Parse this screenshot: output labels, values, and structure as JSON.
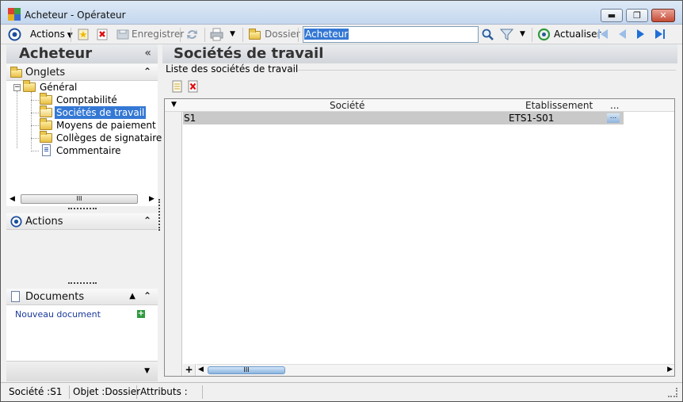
{
  "window": {
    "title": "Acheteur -  Opérateur",
    "min_label": "▬",
    "max_label": "❐",
    "close_label": "✕"
  },
  "toolbar": {
    "actions_label": "Actions",
    "save_label": "Enregistrer",
    "folder_label": "Dossier",
    "search_value": "Acheteur",
    "refresh_label": "Actualiser"
  },
  "left": {
    "title": "Acheteur",
    "collapse_glyph": "«",
    "tabs_header": "Onglets",
    "tree": {
      "root": "Général",
      "items": [
        {
          "label": "Comptabilité",
          "selected": false
        },
        {
          "label": "Sociétés de travail",
          "selected": true
        },
        {
          "label": "Moyens de paiement",
          "selected": false
        },
        {
          "label": "Collèges de signataire",
          "selected": false
        },
        {
          "label": "Commentaire",
          "selected": false
        }
      ]
    },
    "actions_header": "Actions",
    "documents_header": "Documents",
    "new_document_link": "Nouveau document",
    "scroll_grip": "III"
  },
  "main": {
    "title": "Sociétés de travail",
    "group_label": "Liste des sociétés de travail",
    "grid": {
      "columns": [
        "Société",
        "Etablissement",
        "..."
      ],
      "rows": [
        {
          "societe": "S1",
          "etablissement": "ETS1-S01"
        }
      ],
      "row_ellipsis": "...",
      "add_row_glyph": "+"
    }
  },
  "statusbar": {
    "societe": "Société :S1",
    "objet": "Objet :Dossier",
    "attributs": "Attributs :"
  },
  "colors": {
    "selection": "#3478d4",
    "row_highlight": "#c9c9c9",
    "link": "#1a3a9a",
    "nav_blue": "#1f6fd6"
  }
}
